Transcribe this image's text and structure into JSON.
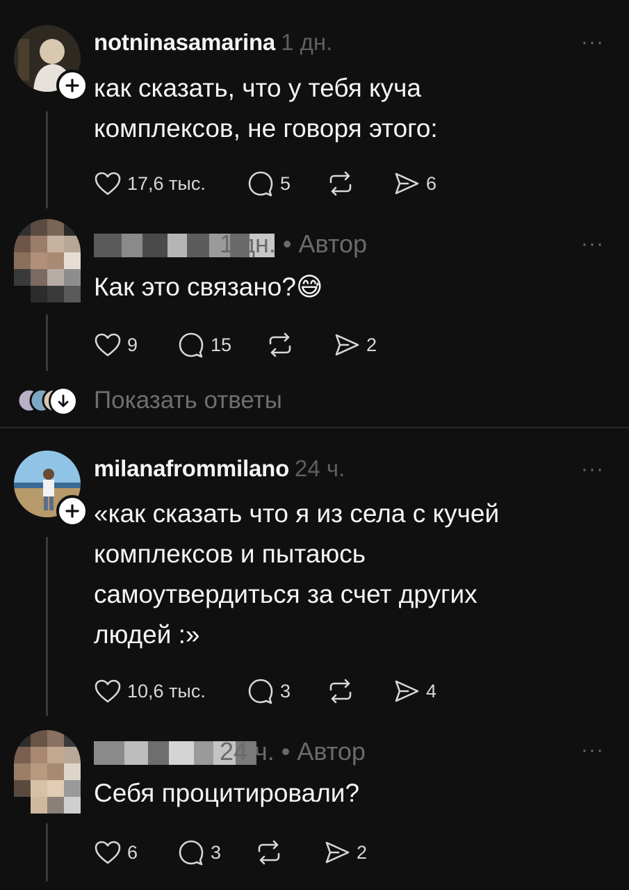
{
  "threads": [
    {
      "comment": {
        "username": "notninasamarina",
        "time": "1 дн.",
        "text_lines": [
          "как сказать, что у тебя куча",
          "комплексов, не говоря этого:"
        ],
        "likes": "17,6 тыс.",
        "replies": "5",
        "shares": "6"
      },
      "reply": {
        "time_author": "1 дн. • Автор",
        "text": "Как это связано?",
        "emoji": "😅",
        "likes": "9",
        "replies": "15",
        "shares": "2"
      },
      "show_replies_label": "Показать ответы"
    },
    {
      "comment": {
        "username": "milanafrommilano",
        "time": "24 ч.",
        "text_lines": [
          "«как сказать что я из села с кучей",
          "комплексов и пытаюсь",
          "самоутвердиться за счет других",
          "людей :»"
        ],
        "likes": "10,6 тыс.",
        "replies": "3",
        "shares": "4"
      },
      "reply": {
        "time_author": "24 ч. • Автор",
        "text": "Себя процитировали?",
        "likes": "6",
        "replies": "3",
        "shares": "2"
      }
    }
  ],
  "more_icon": "···",
  "colors": {
    "background": "#101010",
    "text": "#f5f5f5",
    "muted": "#6a6a6a",
    "thread_line": "#3a3a3a"
  }
}
